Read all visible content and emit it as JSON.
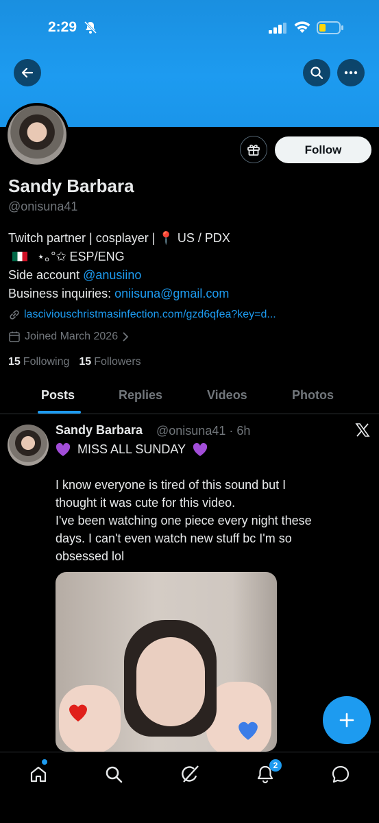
{
  "status_bar": {
    "time": "2:29"
  },
  "header": {
    "follow_label": "Follow"
  },
  "profile": {
    "display_name": "Sandy Barbara",
    "handle": "@onisuna41",
    "bio_line1": "Twitch partner | cosplayer | 📍 US / PDX",
    "bio_line2": "⋆｡°✩ ESP/ENG",
    "bio_line3_prefix": "Side account ",
    "bio_line3_link": "@anusiino",
    "bio_line4_prefix": "Business inquiries: ",
    "bio_line4_link": "oniisuna@gmail.com",
    "website": "lasciviouschristmasinfection.com/gzd6qfea?key=d...",
    "joined": "Joined March 2026",
    "following_count": "15",
    "following_label": "Following",
    "followers_count": "15",
    "followers_label": "Followers"
  },
  "tabs": [
    {
      "label": "Posts"
    },
    {
      "label": "Replies"
    },
    {
      "label": "Videos"
    },
    {
      "label": "Photos"
    }
  ],
  "post": {
    "author_name": "Sandy Barbara",
    "author_meta": "@onisuna41 · 6h",
    "title": "MISS ALL SUNDAY",
    "body_line1": "I know everyone is tired of this sound but I",
    "body_line2": "thought it was cute for this video.",
    "body_line3": "I've been watching one piece every night these",
    "body_line4": "days. I can't even watch new stuff bc I'm so",
    "body_line5": "obsessed lol"
  },
  "bottom_nav": {
    "notifications_badge": "2"
  },
  "colors": {
    "accent": "#1d9bf0",
    "background": "#000000",
    "banner": "#1d9bf0"
  }
}
